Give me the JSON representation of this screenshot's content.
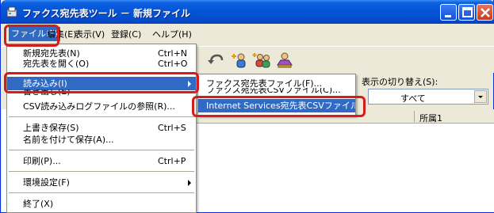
{
  "window": {
    "title": "ファクス宛先表ツール － 新規ファイル"
  },
  "menubar": {
    "items": [
      {
        "label": "ファイル(F)"
      },
      {
        "label": "編集(E)"
      },
      {
        "label": "表示(V)"
      },
      {
        "label": "登録(C)"
      },
      {
        "label": "ヘルプ(H)"
      }
    ]
  },
  "file_menu": {
    "items": [
      {
        "label": "新規宛先表(N)",
        "shortcut": "Ctrl+N"
      },
      {
        "label": "宛先表を開く(O)",
        "shortcut": "Ctrl+O"
      },
      {
        "label": "読み込み(I)",
        "shortcut": ""
      },
      {
        "label": "書き出し(E)",
        "shortcut": ""
      },
      {
        "label": "CSV読み込みログファイルの参照(R)...",
        "shortcut": ""
      },
      {
        "label": "上書き保存(S)",
        "shortcut": "Ctrl+S"
      },
      {
        "label": "名前を付けて保存(A)...",
        "shortcut": ""
      },
      {
        "label": "印刷(P)...",
        "shortcut": "Ctrl+P"
      },
      {
        "label": "環境設定(F)",
        "shortcut": ""
      },
      {
        "label": "終了(X)",
        "shortcut": ""
      }
    ]
  },
  "import_submenu": {
    "items": [
      {
        "label": "ファクス宛先表ファイル(F)..."
      },
      {
        "label": "ファクス宛先表CSVファイル(C)..."
      },
      {
        "label": "Internet Services宛先表CSVファイル(I)..."
      }
    ]
  },
  "display_switch": {
    "label": "表示の切り替え(S):",
    "value": "すべて"
  },
  "list": {
    "columns": [
      "所属1"
    ]
  },
  "colors": {
    "titlebar": "#0554d8",
    "highlight": "#316ac5",
    "annotation": "#d31c1c"
  }
}
